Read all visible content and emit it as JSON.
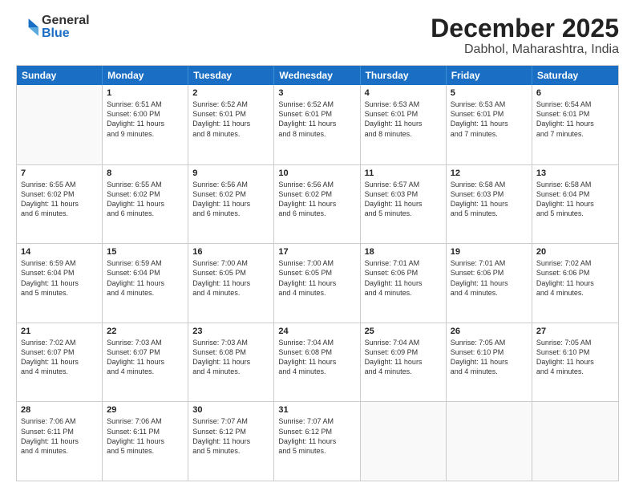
{
  "logo": {
    "general": "General",
    "blue": "Blue"
  },
  "title": "December 2025",
  "subtitle": "Dabhol, Maharashtra, India",
  "header_days": [
    "Sunday",
    "Monday",
    "Tuesday",
    "Wednesday",
    "Thursday",
    "Friday",
    "Saturday"
  ],
  "weeks": [
    [
      {
        "day": "",
        "info": ""
      },
      {
        "day": "1",
        "info": "Sunrise: 6:51 AM\nSunset: 6:00 PM\nDaylight: 11 hours\nand 9 minutes."
      },
      {
        "day": "2",
        "info": "Sunrise: 6:52 AM\nSunset: 6:01 PM\nDaylight: 11 hours\nand 8 minutes."
      },
      {
        "day": "3",
        "info": "Sunrise: 6:52 AM\nSunset: 6:01 PM\nDaylight: 11 hours\nand 8 minutes."
      },
      {
        "day": "4",
        "info": "Sunrise: 6:53 AM\nSunset: 6:01 PM\nDaylight: 11 hours\nand 8 minutes."
      },
      {
        "day": "5",
        "info": "Sunrise: 6:53 AM\nSunset: 6:01 PM\nDaylight: 11 hours\nand 7 minutes."
      },
      {
        "day": "6",
        "info": "Sunrise: 6:54 AM\nSunset: 6:01 PM\nDaylight: 11 hours\nand 7 minutes."
      }
    ],
    [
      {
        "day": "7",
        "info": "Sunrise: 6:55 AM\nSunset: 6:02 PM\nDaylight: 11 hours\nand 6 minutes."
      },
      {
        "day": "8",
        "info": "Sunrise: 6:55 AM\nSunset: 6:02 PM\nDaylight: 11 hours\nand 6 minutes."
      },
      {
        "day": "9",
        "info": "Sunrise: 6:56 AM\nSunset: 6:02 PM\nDaylight: 11 hours\nand 6 minutes."
      },
      {
        "day": "10",
        "info": "Sunrise: 6:56 AM\nSunset: 6:02 PM\nDaylight: 11 hours\nand 6 minutes."
      },
      {
        "day": "11",
        "info": "Sunrise: 6:57 AM\nSunset: 6:03 PM\nDaylight: 11 hours\nand 5 minutes."
      },
      {
        "day": "12",
        "info": "Sunrise: 6:58 AM\nSunset: 6:03 PM\nDaylight: 11 hours\nand 5 minutes."
      },
      {
        "day": "13",
        "info": "Sunrise: 6:58 AM\nSunset: 6:04 PM\nDaylight: 11 hours\nand 5 minutes."
      }
    ],
    [
      {
        "day": "14",
        "info": "Sunrise: 6:59 AM\nSunset: 6:04 PM\nDaylight: 11 hours\nand 5 minutes."
      },
      {
        "day": "15",
        "info": "Sunrise: 6:59 AM\nSunset: 6:04 PM\nDaylight: 11 hours\nand 4 minutes."
      },
      {
        "day": "16",
        "info": "Sunrise: 7:00 AM\nSunset: 6:05 PM\nDaylight: 11 hours\nand 4 minutes."
      },
      {
        "day": "17",
        "info": "Sunrise: 7:00 AM\nSunset: 6:05 PM\nDaylight: 11 hours\nand 4 minutes."
      },
      {
        "day": "18",
        "info": "Sunrise: 7:01 AM\nSunset: 6:06 PM\nDaylight: 11 hours\nand 4 minutes."
      },
      {
        "day": "19",
        "info": "Sunrise: 7:01 AM\nSunset: 6:06 PM\nDaylight: 11 hours\nand 4 minutes."
      },
      {
        "day": "20",
        "info": "Sunrise: 7:02 AM\nSunset: 6:06 PM\nDaylight: 11 hours\nand 4 minutes."
      }
    ],
    [
      {
        "day": "21",
        "info": "Sunrise: 7:02 AM\nSunset: 6:07 PM\nDaylight: 11 hours\nand 4 minutes."
      },
      {
        "day": "22",
        "info": "Sunrise: 7:03 AM\nSunset: 6:07 PM\nDaylight: 11 hours\nand 4 minutes."
      },
      {
        "day": "23",
        "info": "Sunrise: 7:03 AM\nSunset: 6:08 PM\nDaylight: 11 hours\nand 4 minutes."
      },
      {
        "day": "24",
        "info": "Sunrise: 7:04 AM\nSunset: 6:08 PM\nDaylight: 11 hours\nand 4 minutes."
      },
      {
        "day": "25",
        "info": "Sunrise: 7:04 AM\nSunset: 6:09 PM\nDaylight: 11 hours\nand 4 minutes."
      },
      {
        "day": "26",
        "info": "Sunrise: 7:05 AM\nSunset: 6:10 PM\nDaylight: 11 hours\nand 4 minutes."
      },
      {
        "day": "27",
        "info": "Sunrise: 7:05 AM\nSunset: 6:10 PM\nDaylight: 11 hours\nand 4 minutes."
      }
    ],
    [
      {
        "day": "28",
        "info": "Sunrise: 7:06 AM\nSunset: 6:11 PM\nDaylight: 11 hours\nand 4 minutes."
      },
      {
        "day": "29",
        "info": "Sunrise: 7:06 AM\nSunset: 6:11 PM\nDaylight: 11 hours\nand 5 minutes."
      },
      {
        "day": "30",
        "info": "Sunrise: 7:07 AM\nSunset: 6:12 PM\nDaylight: 11 hours\nand 5 minutes."
      },
      {
        "day": "31",
        "info": "Sunrise: 7:07 AM\nSunset: 6:12 PM\nDaylight: 11 hours\nand 5 minutes."
      },
      {
        "day": "",
        "info": ""
      },
      {
        "day": "",
        "info": ""
      },
      {
        "day": "",
        "info": ""
      }
    ]
  ]
}
